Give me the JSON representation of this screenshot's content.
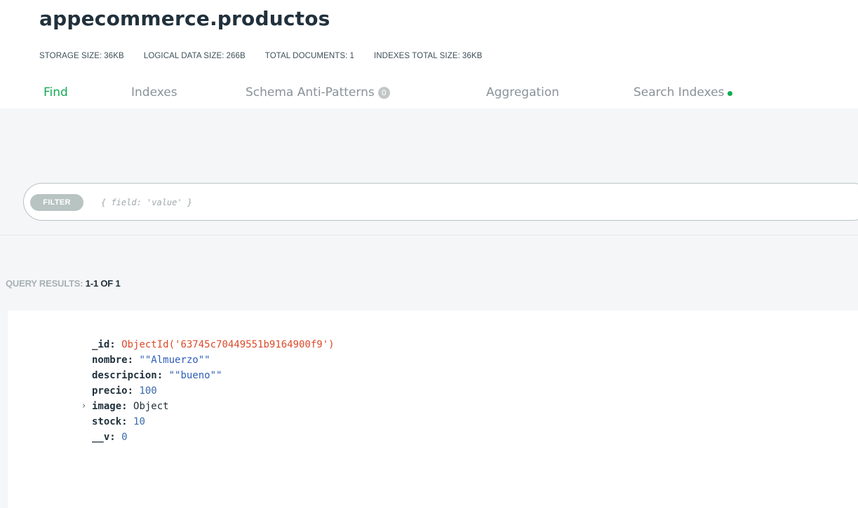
{
  "header": {
    "title": "appecommerce.productos",
    "stats": [
      {
        "label": "STORAGE SIZE:",
        "value": "36KB"
      },
      {
        "label": "LOGICAL DATA SIZE:",
        "value": "266B"
      },
      {
        "label": "TOTAL DOCUMENTS:",
        "value": "1"
      },
      {
        "label": "INDEXES TOTAL SIZE:",
        "value": "36KB"
      }
    ]
  },
  "tabs": {
    "find": "Find",
    "indexes": "Indexes",
    "anti_patterns": "Schema Anti-Patterns",
    "anti_patterns_count": "0",
    "aggregation": "Aggregation",
    "search_indexes": "Search Indexes"
  },
  "filter": {
    "label": "FILTER",
    "placeholder": "{ field: 'value' }"
  },
  "results": {
    "label": "QUERY RESULTS:",
    "count": "1-1 OF 1"
  },
  "document": {
    "fields": [
      {
        "key": "_id:",
        "value": "ObjectId('63745c70449551b9164900f9')"
      },
      {
        "key": "nombre:",
        "value": "\"\"Almuerzo\"\""
      },
      {
        "key": "descripcion:",
        "value": "\"\"bueno\"\""
      },
      {
        "key": "precio:",
        "value": "100"
      },
      {
        "key": "image:",
        "value": "Object"
      },
      {
        "key": "stock:",
        "value": "10"
      },
      {
        "key": "__v:",
        "value": "0"
      }
    ]
  },
  "colors": {
    "accent": "#13aa52",
    "objectid": "#db4a2a",
    "string": "#2f5db8"
  }
}
